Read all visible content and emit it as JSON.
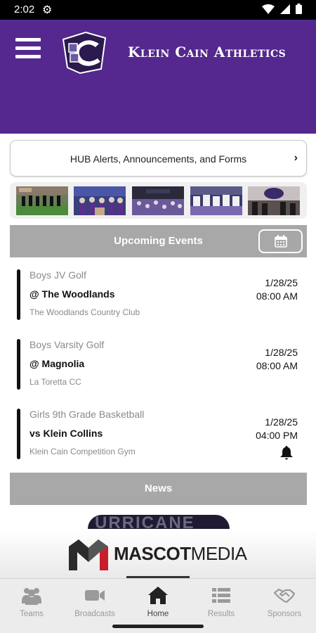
{
  "status_bar": {
    "time": "2:02"
  },
  "header": {
    "title": "Klein Cain Athletics"
  },
  "hub": {
    "label": "HUB Alerts, Announcements, and Forms"
  },
  "upcoming": {
    "title": "Upcoming Events"
  },
  "events": [
    {
      "sport": "Boys JV Golf",
      "opponent": "@ The Woodlands",
      "venue": "The Woodlands Country Club",
      "date": "1/28/25",
      "time": "08:00 AM",
      "has_bell": false
    },
    {
      "sport": "Boys Varsity Golf",
      "opponent": "@ Magnolia",
      "venue": "La Toretta CC",
      "date": "1/28/25",
      "time": "08:00 AM",
      "has_bell": false
    },
    {
      "sport": "Girls 9th Grade Basketball",
      "opponent": "vs Klein Collins",
      "venue": "Klein Cain Competition Gym",
      "date": "1/28/25",
      "time": "04:00 PM",
      "has_bell": true
    }
  ],
  "news": {
    "title": "News",
    "banner_text": "URRICANE"
  },
  "sponsor": {
    "name_part1": "MASCOT",
    "name_part2": "MEDIA"
  },
  "nav": [
    {
      "label": "Teams",
      "icon": "teams-icon"
    },
    {
      "label": "Broadcasts",
      "icon": "video-camera-icon"
    },
    {
      "label": "Home",
      "icon": "home-icon"
    },
    {
      "label": "Results",
      "icon": "list-icon"
    },
    {
      "label": "Sponsors",
      "icon": "handshake-icon"
    }
  ],
  "colors": {
    "header": "#54288e",
    "section": "#a8a8a8"
  }
}
